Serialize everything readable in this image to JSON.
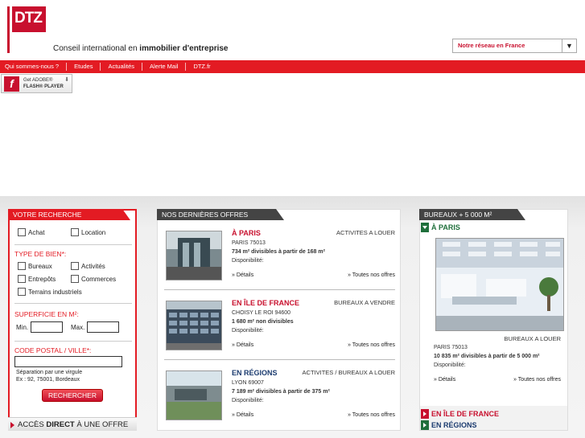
{
  "header": {
    "logo_text": "DTZ",
    "tagline_prefix": "Conseil international en ",
    "tagline_bold": "immobilier d'entreprise",
    "network_select": "Notre réseau en France"
  },
  "nav": {
    "items": [
      "Qui sommes-nous ?",
      "Etudes",
      "Actualités",
      "Alerte Mail",
      "DTZ.fr"
    ]
  },
  "flash_badge": {
    "line1": "Get ADOBE®",
    "line2": "FLASH® PLAYER"
  },
  "search": {
    "title": "VOTRE RECHERCHE",
    "achat": "Achat",
    "location": "Location",
    "type_title": "TYPE DE BIEN*:",
    "bureaux": "Bureaux",
    "activites": "Activités",
    "entrepots": "Entrepôts",
    "commerces": "Commerces",
    "terrains": "Terrains industriels",
    "superficie_title": "SUPERFICIE EN M²:",
    "min": "Min.",
    "max": "Max.",
    "cp_title": "CODE POSTAL / VILLE*:",
    "hint1": "Séparation par une virgule",
    "hint2": "Ex : 92, 75001, Bordeaux",
    "button": "RECHERCHER",
    "acces_prefix": "ACCÈS ",
    "acces_bold": "DIRECT",
    "acces_suffix": " À UNE OFFRE"
  },
  "offers": {
    "title": "NOS DERNIÈRES OFFRES",
    "items": [
      {
        "loc1": "À ",
        "loc2": "PARIS",
        "type": "ACTIVITES A LOUER",
        "city": "PARIS 75013",
        "surface": "734 m² divisibles à partir de 168 m²",
        "disp": "Disponibilité:",
        "details": "» Détails",
        "all": "» Toutes nos offres"
      },
      {
        "loc1": "EN ",
        "loc2": "ÎLE DE FRANCE",
        "type": "BUREAUX A VENDRE",
        "city": "CHOISY LE ROI 94600",
        "surface": "1 680 m² non divisibles",
        "disp": "Disponibilité:",
        "details": "» Détails",
        "all": "» Toutes nos offres"
      },
      {
        "loc1": "EN ",
        "loc2": "RÉGIONS",
        "type": "ACTIVITES / BUREAUX A LOUER",
        "city": "LYON 69007",
        "surface": "7 189 m² divisibles à partir de 375 m²",
        "disp": "Disponibilité:",
        "details": "» Détails",
        "all": "» Toutes nos offres"
      }
    ]
  },
  "bureaux": {
    "title": "BUREAUX + 5 000 M²",
    "tab_paris": "À PARIS",
    "type": "BUREAUX A LOUER",
    "city": "PARIS 75013",
    "surface": "10 835 m² divisibles à partir de 5 000 m²",
    "disp": "Disponibilité:",
    "details": "» Détails",
    "all": "» Toutes nos offres",
    "tab_idf": "EN ÎLE DE FRANCE",
    "tab_regions": "EN RÉGIONS"
  }
}
